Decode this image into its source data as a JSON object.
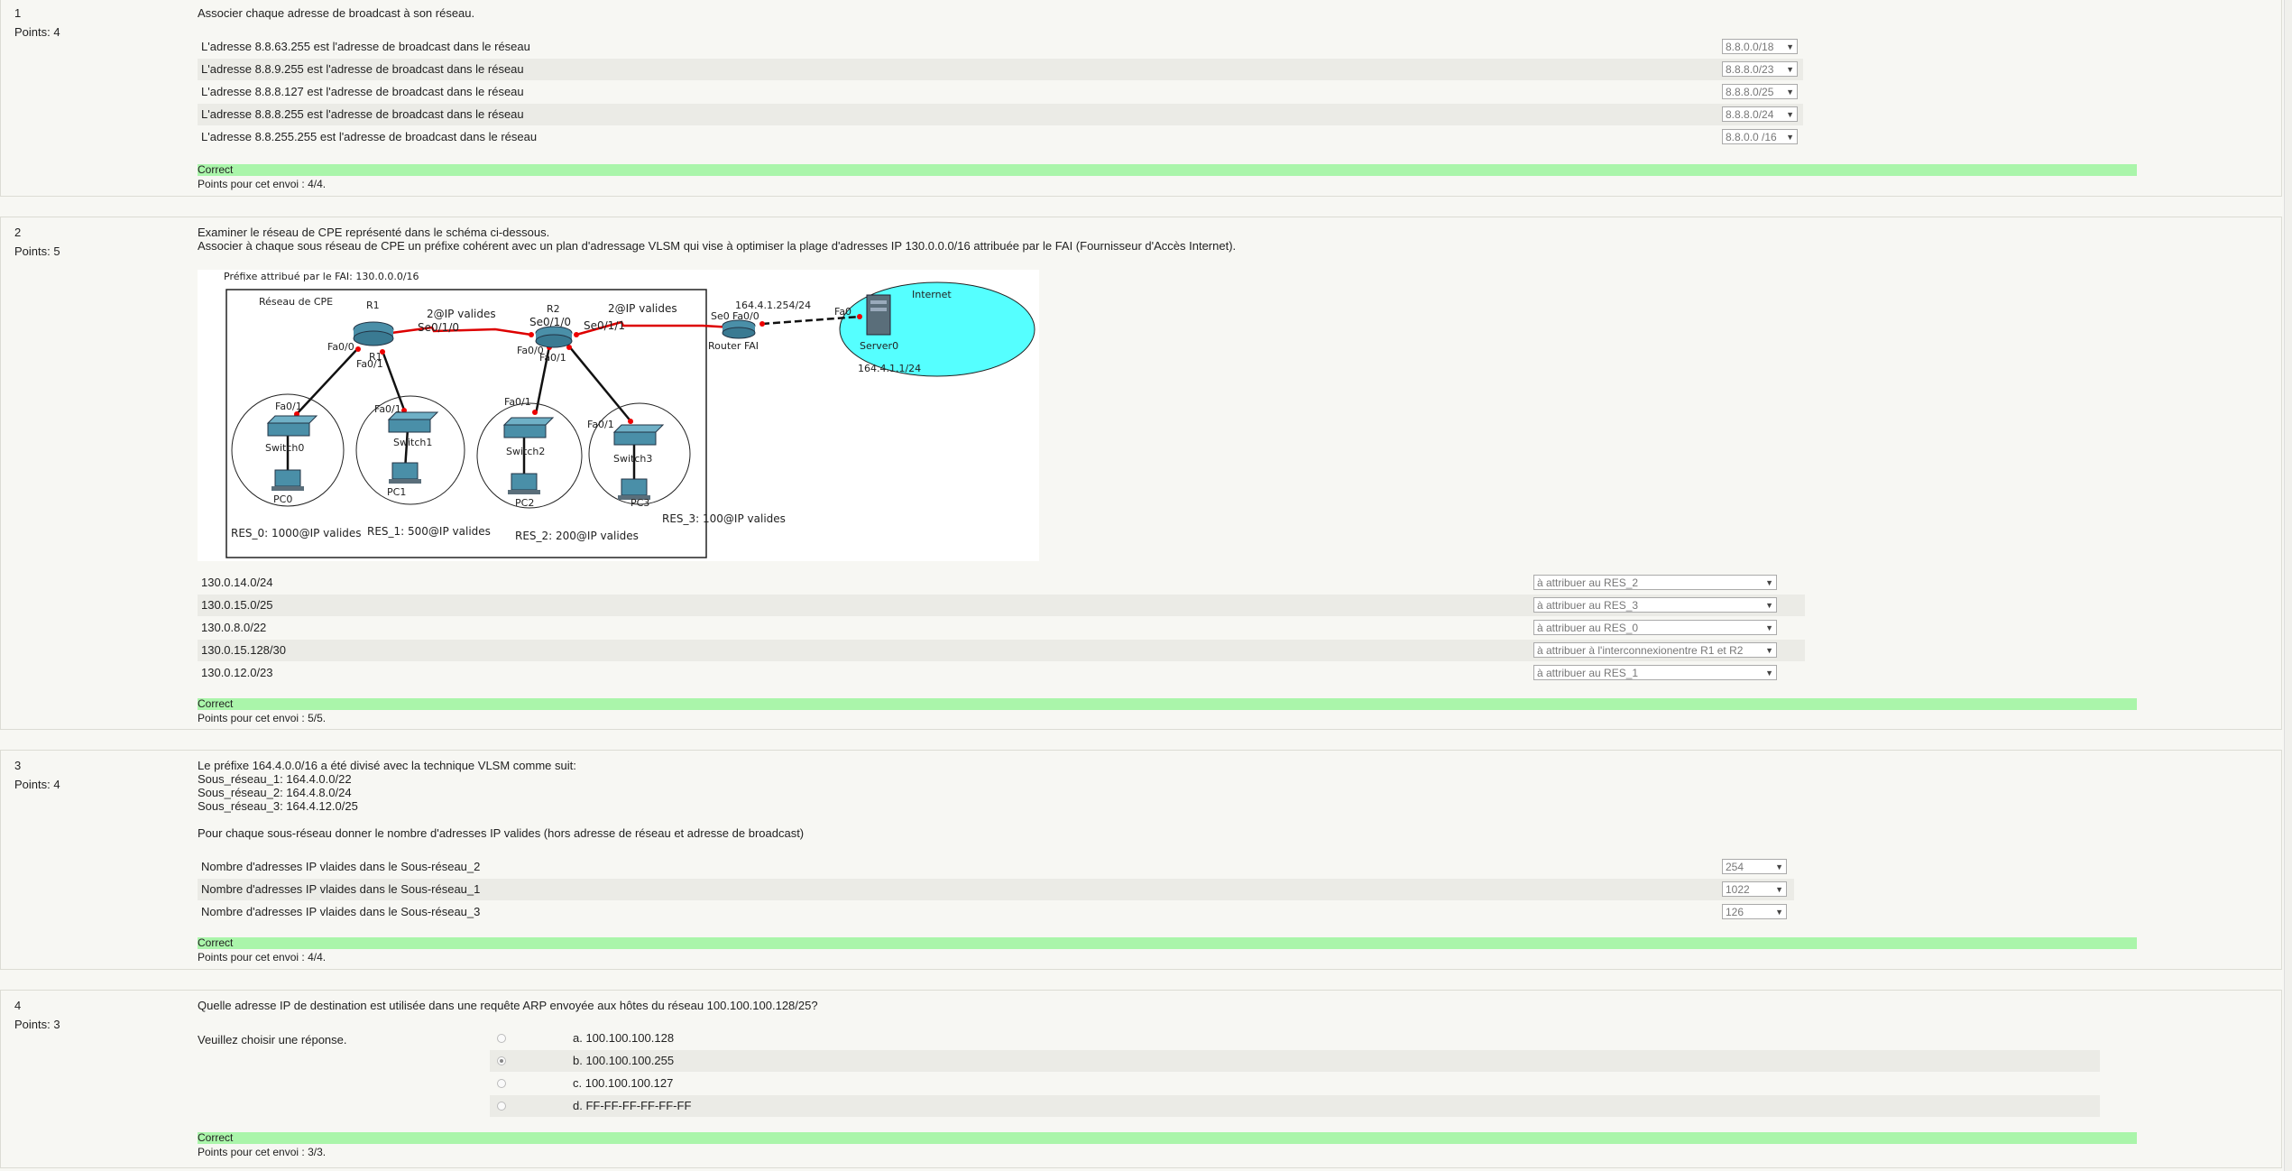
{
  "questions": [
    {
      "number": "1",
      "points": "Points: 4",
      "stem": "Associer chaque adresse de broadcast à son réseau.",
      "rows": [
        {
          "label": "L'adresse 8.8.63.255 est l'adresse de broadcast dans le réseau",
          "value": "8.8.0.0/18"
        },
        {
          "label": "L'adresse 8.8.9.255 est l'adresse de broadcast dans le réseau",
          "value": "8.8.8.0/23"
        },
        {
          "label": "L'adresse 8.8.8.127 est l'adresse de broadcast dans le réseau",
          "value": "8.8.8.0/25"
        },
        {
          "label": "L'adresse 8.8.8.255 est l'adresse de broadcast dans le réseau",
          "value": "8.8.8.0/24"
        },
        {
          "label": "L'adresse 8.8.255.255 est l'adresse de broadcast dans le réseau",
          "value": "8.8.0.0 /16"
        }
      ],
      "feedback": "Correct",
      "score": "Points pour cet envoi : 4/4."
    },
    {
      "number": "2",
      "points": "Points: 5",
      "stem_line1": "Examiner le réseau de CPE représenté dans le schéma ci-dessous.",
      "stem_line2": "Associer à chaque sous réseau de CPE un préfixe cohérent avec un plan d'adressage VLSM qui vise à optimiser la plage d'adresses IP 130.0.0.0/16 attribuée par le FAI (Fournisseur d'Accès Internet).",
      "diagram": {
        "prefix_note": "Préfixe attribué par le FAI: 130.0.0.0/16",
        "cpe_label": "Réseau de CPE",
        "r1": "R1",
        "r2": "R2",
        "r1_sub": "R1",
        "link1": "2@IP valides",
        "link2": "2@IP valides",
        "se010_a": "Se0/1/0",
        "se010_b": "Se0/1/0",
        "se011": "Se0/1/1",
        "se0": "Se0",
        "fa00_r1": "Fa0/0",
        "fa01_r1": "Fa0/1",
        "fa00_r2": "Fa0/0",
        "fa01_r2": "Fa0/1",
        "fa00_fai": "Fa0/0",
        "fai_ip": "164.4.1.254/24",
        "router_fai": "Router FAI",
        "fa0_srv": "Fa0",
        "internet": "Internet",
        "server": "Server0",
        "server_ip": "164.4.1.1/24",
        "sw0_port": "Fa0/1",
        "sw1_port": "Fa0/1",
        "sw2_port": "Fa0/1",
        "sw3_port": "Fa0/1",
        "switch0": "Switch0",
        "switch1": "Switch1",
        "switch2": "Switch2",
        "switch3": "Switch3",
        "pc0": "PC0",
        "pc1": "PC1",
        "pc2": "PC2",
        "pc3": "PC3",
        "res0": "RES_0: 1000@IP valides",
        "res1": "RES_1: 500@IP valides",
        "res2": "RES_2: 200@IP valides",
        "res3": "RES_3: 100@IP valides"
      },
      "rows": [
        {
          "label": "130.0.14.0/24",
          "value": "à attribuer au RES_2"
        },
        {
          "label": "130.0.15.0/25",
          "value": "à attribuer au RES_3"
        },
        {
          "label": "130.0.8.0/22",
          "value": "à attribuer au RES_0"
        },
        {
          "label": "130.0.15.128/30",
          "value": "à attribuer à l'interconnexionentre R1 et R2"
        },
        {
          "label": "130.0.12.0/23",
          "value": "à attribuer au RES_1"
        }
      ],
      "feedback": "Correct",
      "score": "Points pour cet envoi : 5/5."
    },
    {
      "number": "3",
      "points": "Points: 4",
      "stem_lines": [
        "Le préfixe 164.4.0.0/16 a été divisé avec la technique VLSM comme suit:",
        "Sous_réseau_1: 164.4.0.0/22",
        "Sous_réseau_2: 164.4.8.0/24",
        "Sous_réseau_3: 164.4.12.0/25",
        "",
        "Pour chaque sous-réseau donner le nombre d'adresses IP valides (hors adresse de réseau et adresse de broadcast)"
      ],
      "rows": [
        {
          "label": "Nombre d'adresses IP vlaides dans le Sous-réseau_2",
          "value": "254"
        },
        {
          "label": "Nombre d'adresses IP vlaides dans le Sous-réseau_1",
          "value": "1022"
        },
        {
          "label": "Nombre d'adresses IP vlaides dans le Sous-réseau_3",
          "value": "126"
        }
      ],
      "feedback": "Correct",
      "score": "Points pour cet envoi : 4/4."
    },
    {
      "number": "4",
      "points": "Points: 3",
      "stem": "Quelle adresse IP de destination est utilisée dans une requête ARP envoyée aux hôtes du réseau 100.100.100.128/25?",
      "prompt": "Veuillez choisir une réponse.",
      "options": [
        {
          "label": "a. 100.100.100.128",
          "checked": false
        },
        {
          "label": "b. 100.100.100.255",
          "checked": true
        },
        {
          "label": "c. 100.100.100.127",
          "checked": false
        },
        {
          "label": "d. FF-FF-FF-FF-FF-FF",
          "checked": false
        }
      ],
      "feedback": "Correct",
      "score": "Points pour cet envoi : 3/3."
    }
  ]
}
